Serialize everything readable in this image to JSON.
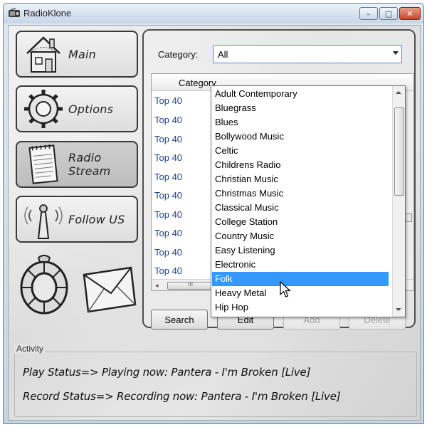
{
  "window": {
    "title": "RadioKlone",
    "controls": {
      "minimize": "–",
      "maximize": "□",
      "close": "✕"
    }
  },
  "nav": [
    {
      "label": "Main",
      "icon": "house-icon"
    },
    {
      "label": "Options",
      "icon": "gear-icon"
    },
    {
      "label": "Radio Stream",
      "icon": "notepad-icon"
    },
    {
      "label": "Follow US",
      "icon": "antenna-icon"
    }
  ],
  "decorations": [
    "lifebuoy-icon",
    "envelope-icon"
  ],
  "category": {
    "label": "Category:",
    "value": "All"
  },
  "grid": {
    "header": "Category",
    "rows": [
      "Top 40",
      "Top 40",
      "Top 40",
      "Top 40",
      "Top 40",
      "Top 40",
      "Top 40",
      "Top 40",
      "Top 40",
      "Top 40"
    ],
    "hscroll_grip": "III"
  },
  "dropdown": {
    "items": [
      "Adult Contemporary",
      "Bluegrass",
      "Blues",
      "Bollywood Music",
      "Celtic",
      "Childrens Radio",
      "Christian Music",
      "Christmas Music",
      "Classical Music",
      "College Station",
      "Country Music",
      "Easy Listening",
      "Electronic",
      "Folk",
      "Heavy Metal",
      "Hip Hop"
    ],
    "selected": "Folk"
  },
  "buttons": {
    "search": "Search",
    "edit": "Edit",
    "add": "Add",
    "delete": "Delete"
  },
  "activity": {
    "legend": "Activity",
    "play_status": "Play Status=> Playing now: Pantera - I'm Broken [Live]",
    "record_status": "Record Status=> Recording now: Pantera - I'm Broken [Live]"
  },
  "colors": {
    "selection": "#3399ff",
    "link_text": "#1f3f8f",
    "combo_border": "#4f8ad4"
  }
}
